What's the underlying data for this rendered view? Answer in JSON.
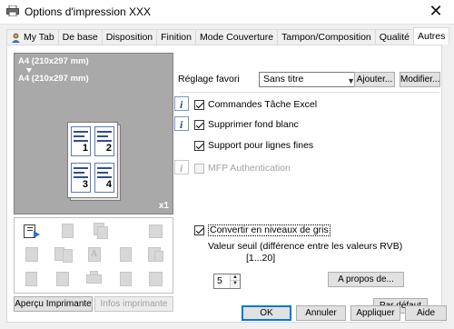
{
  "window": {
    "title": "Options d'impression XXX",
    "close_glyph": "✕"
  },
  "tabs": [
    {
      "label": "My Tab",
      "active": false
    },
    {
      "label": "De base",
      "active": false
    },
    {
      "label": "Disposition",
      "active": false
    },
    {
      "label": "Finition",
      "active": false
    },
    {
      "label": "Mode Couverture",
      "active": false
    },
    {
      "label": "Tampon/Composition",
      "active": false
    },
    {
      "label": "Qualité",
      "active": false
    },
    {
      "label": "Autres",
      "active": true
    }
  ],
  "preview": {
    "original_size": "A4 (210x297 mm)",
    "output_size": "A4 (210x297 mm)",
    "copies": "x1",
    "page_numbers": [
      "1",
      "2",
      "3",
      "4"
    ]
  },
  "icons": [
    "print-settings-icon",
    "page-icon",
    "copy-icon",
    "combine-icon",
    "layout-icon",
    "double-page-icon",
    "font-icon",
    "color-pages-icon",
    "document-list-icon",
    "booklet-icon",
    "stack-icon",
    "printer-icon",
    "watermark-icon",
    "grid-icon"
  ],
  "left_buttons": {
    "printer_preview": "Aperçu Imprimante",
    "printer_info": "Infos imprimante"
  },
  "favorite": {
    "label": "Réglage favori",
    "value": "Sans titre",
    "add_label": "Ajouter...",
    "modify_label": "Modifier..."
  },
  "options": {
    "excel_jobs": "Commandes Tâche Excel",
    "remove_background": "Supprimer fond blanc",
    "thin_lines": "Support pour lignes fines",
    "mfp_auth": "MFP Authentication",
    "grayscale": "Convertir en niveaux de gris"
  },
  "threshold": {
    "label": "Valeur seuil (différence entre les valeurs RVB)",
    "value": "5",
    "range": "[1...20]",
    "about_label": "A propos de..."
  },
  "default_label": "Par défaut",
  "footer": {
    "ok": "OK",
    "cancel": "Annuler",
    "apply": "Appliquer",
    "help": "Aide"
  }
}
